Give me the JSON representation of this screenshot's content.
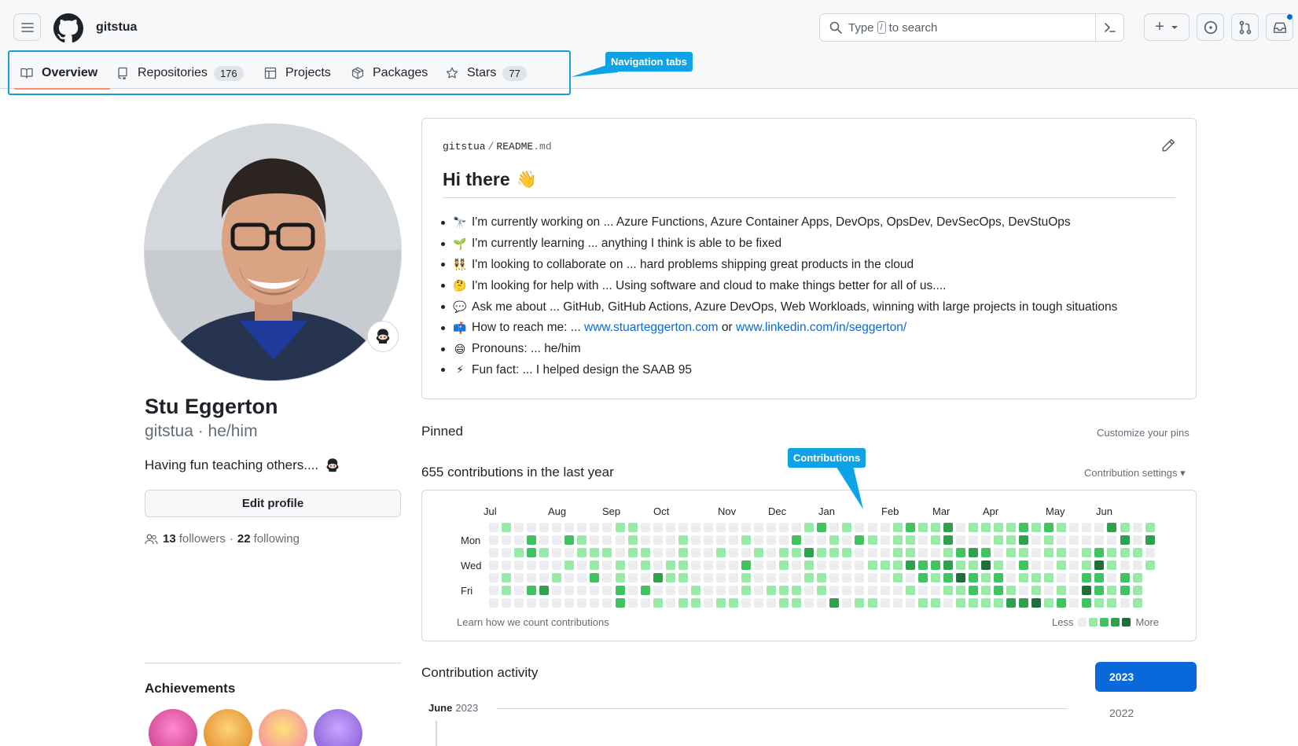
{
  "header": {
    "username": "gitstua",
    "search": {
      "prefix": "Type",
      "key": "/",
      "suffix": "to search"
    },
    "create_label": "+"
  },
  "nav": {
    "tabs": [
      {
        "label": "Overview",
        "count": null
      },
      {
        "label": "Repositories",
        "count": "176"
      },
      {
        "label": "Projects",
        "count": null
      },
      {
        "label": "Packages",
        "count": null
      },
      {
        "label": "Stars",
        "count": "77"
      }
    ],
    "active_tab": "Overview"
  },
  "callouts": {
    "nav": "Navigation tabs",
    "contrib": "Contributions"
  },
  "profile": {
    "full_name": "Stu Eggerton",
    "login": "gitstua",
    "pronouns": "he/him",
    "login_line": "gitstua · he/him",
    "bio": "Having fun teaching others....",
    "edit_label": "Edit profile",
    "followers_count": "13",
    "followers_label": "followers",
    "following_count": "22",
    "following_label": "following",
    "achievements_title": "Achievements"
  },
  "readme": {
    "owner": "gitstua",
    "file": "README",
    "ext": ".md",
    "heading": "Hi there",
    "items": [
      {
        "emoji": "🔭",
        "text": "I'm currently working on ... Azure Functions, Azure Container Apps, DevOps, OpsDev, DevSecOps, DevStuOps"
      },
      {
        "emoji": "🌱",
        "text": "I'm currently learning ... anything I think is able to be fixed"
      },
      {
        "emoji": "👯",
        "text": "I'm looking to collaborate on ... hard problems shipping great products in the cloud"
      },
      {
        "emoji": "🤔",
        "text": "I'm looking for help with ... Using software and cloud to make things better for all of us...."
      },
      {
        "emoji": "💬",
        "text": "Ask me about ... GitHub, GitHub Actions, Azure DevOps, Web Workloads, winning with large projects in tough situations"
      },
      {
        "emoji": "📫",
        "text": "How to reach me: ...",
        "link1": "www.stuarteggerton.com",
        "mid": "or",
        "link2": "www.linkedin.com/in/seggerton/"
      },
      {
        "emoji": "😄",
        "text": "Pronouns: ... he/him"
      },
      {
        "emoji": "⚡",
        "text": "Fun fact: ... I helped design the SAAB 95"
      }
    ]
  },
  "pinned": {
    "title": "Pinned",
    "customize": "Customize your pins"
  },
  "contributions": {
    "title": "655 contributions in the last year",
    "settings": "Contribution settings ▾",
    "months": [
      "Jul",
      "Aug",
      "Sep",
      "Oct",
      "Nov",
      "Dec",
      "Jan",
      "Feb",
      "Mar",
      "Apr",
      "May",
      "Jun"
    ],
    "days": [
      "Mon",
      "Wed",
      "Fri"
    ],
    "learn": "Learn how we count contributions",
    "less": "Less",
    "more": "More",
    "colors": [
      "#ebedf0",
      "#9be9a8",
      "#40c463",
      "#30a14e",
      "#216e39"
    ]
  },
  "activity": {
    "title": "Contribution activity",
    "year_selected": "2023",
    "year_other": "2022",
    "month": "June",
    "month_year": "2023"
  }
}
